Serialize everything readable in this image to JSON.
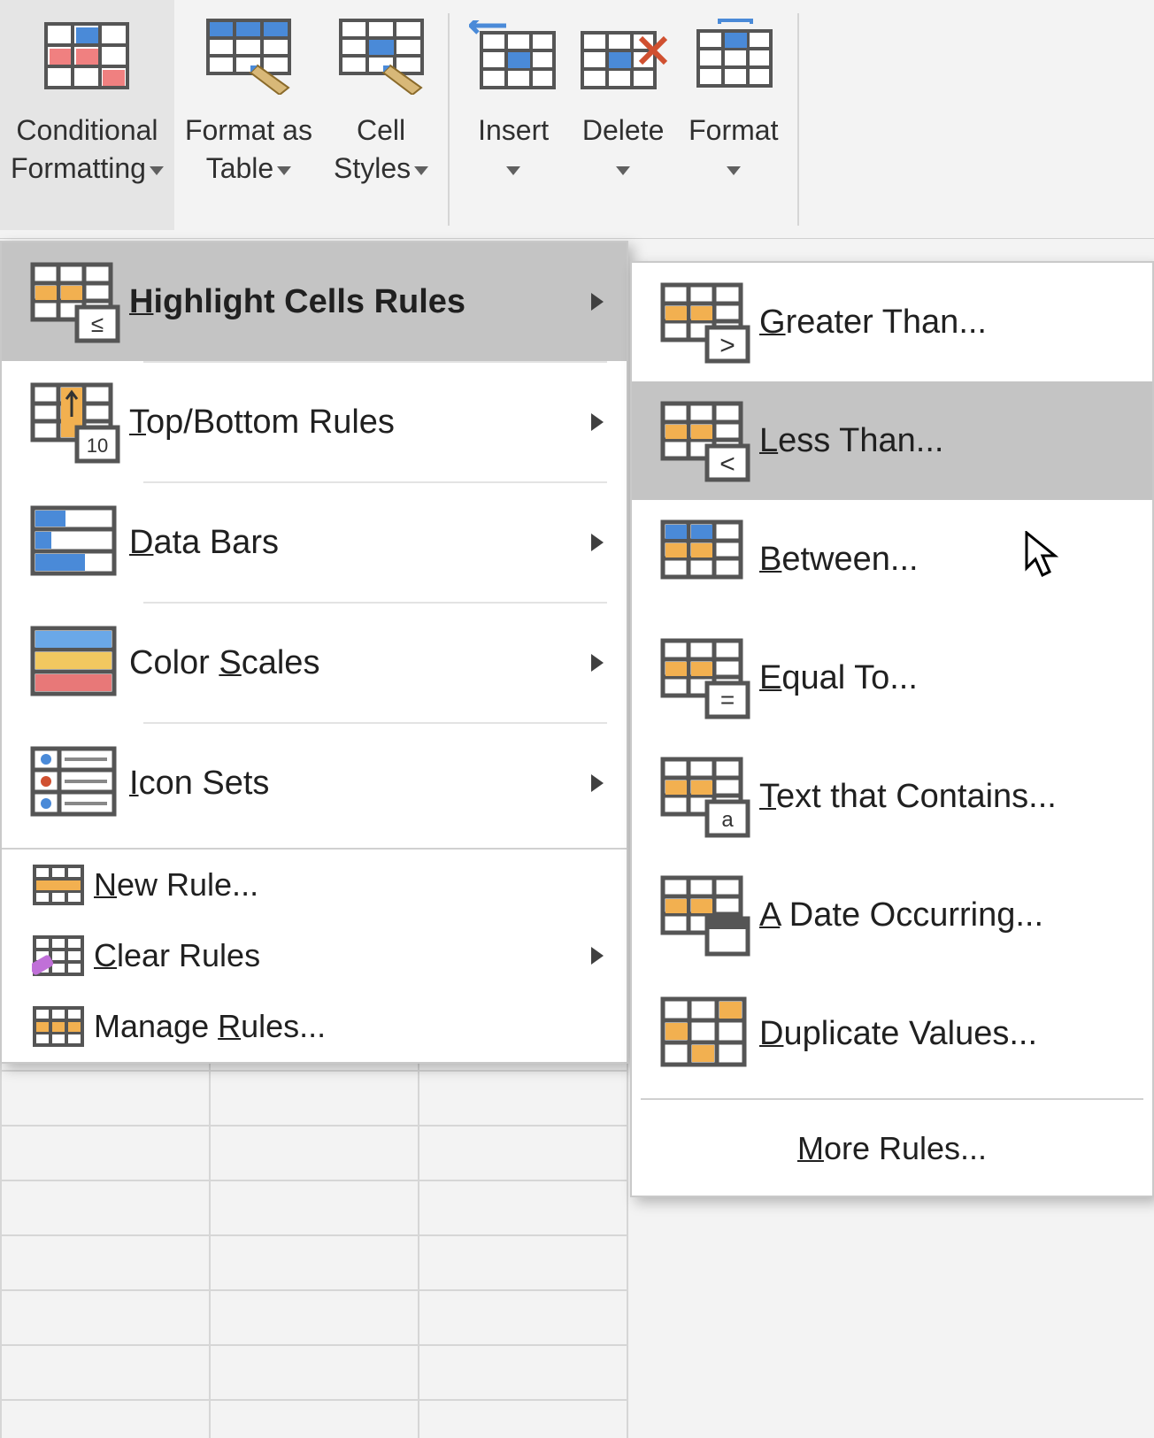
{
  "ribbon": {
    "conditional": {
      "line1": "Conditional",
      "line2": "Formatting"
    },
    "formatTable": {
      "line1": "Format as",
      "line2": "Table"
    },
    "cellStyles": {
      "line1": "Cell",
      "line2": "Styles"
    },
    "insert": "Insert",
    "delete": "Delete",
    "format": "Format"
  },
  "menu1": {
    "highlight": {
      "label": "Highlight Cells Rules",
      "u": "H"
    },
    "topBottom": {
      "label": "Top/Bottom Rules",
      "u": "T"
    },
    "dataBars": {
      "label": "Data Bars",
      "u": "D"
    },
    "colorScales": {
      "label": "Color Scales",
      "u": "S"
    },
    "iconSets": {
      "label": "Icon Sets",
      "u": "I"
    },
    "newRule": {
      "label": "New Rule...",
      "u": "N"
    },
    "clearRules": {
      "label": "Clear Rules",
      "u": "C"
    },
    "manageRules": {
      "label": "Manage Rules...",
      "u": "R"
    }
  },
  "menu2": {
    "greater": {
      "label": "Greater Than...",
      "u": "G"
    },
    "less": {
      "label": "Less Than...",
      "u": "L"
    },
    "between": {
      "label": "Between...",
      "u": "B"
    },
    "equal": {
      "label": "Equal To...",
      "u": "E"
    },
    "text": {
      "label": "Text that Contains...",
      "u": "T"
    },
    "date": {
      "label": "A Date Occurring...",
      "u": "A"
    },
    "duplicate": {
      "label": "Duplicate Values...",
      "u": "D"
    },
    "more": {
      "label": "More Rules...",
      "u": "M"
    }
  }
}
